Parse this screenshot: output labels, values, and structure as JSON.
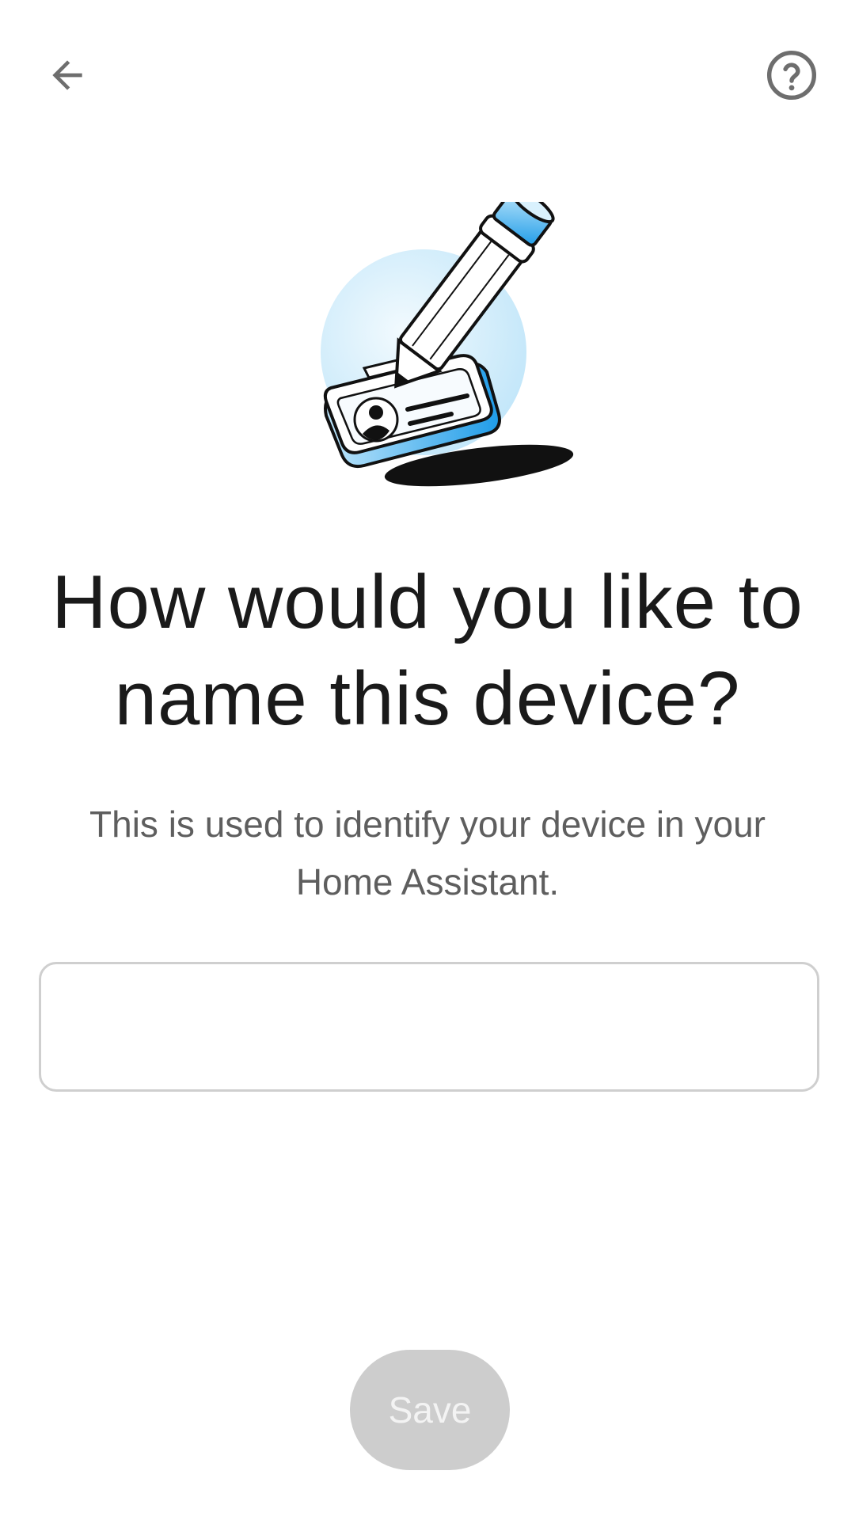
{
  "header": {
    "back_icon": "arrow-left-icon",
    "help_icon": "help-circle-icon"
  },
  "illustration": {
    "name": "pencil-writing-on-id-card",
    "colors": {
      "accent": "#2aa6f0",
      "light_blue": "#dff2fc",
      "outline": "#111111"
    }
  },
  "main": {
    "title": "How would you like to name this device?",
    "subtitle": "This is used to identify your device in your Home Assistant.",
    "name_input": {
      "value": "",
      "placeholder": ""
    }
  },
  "footer": {
    "save_label": "Save",
    "save_enabled": false,
    "save_color": "#cdcdcd"
  }
}
